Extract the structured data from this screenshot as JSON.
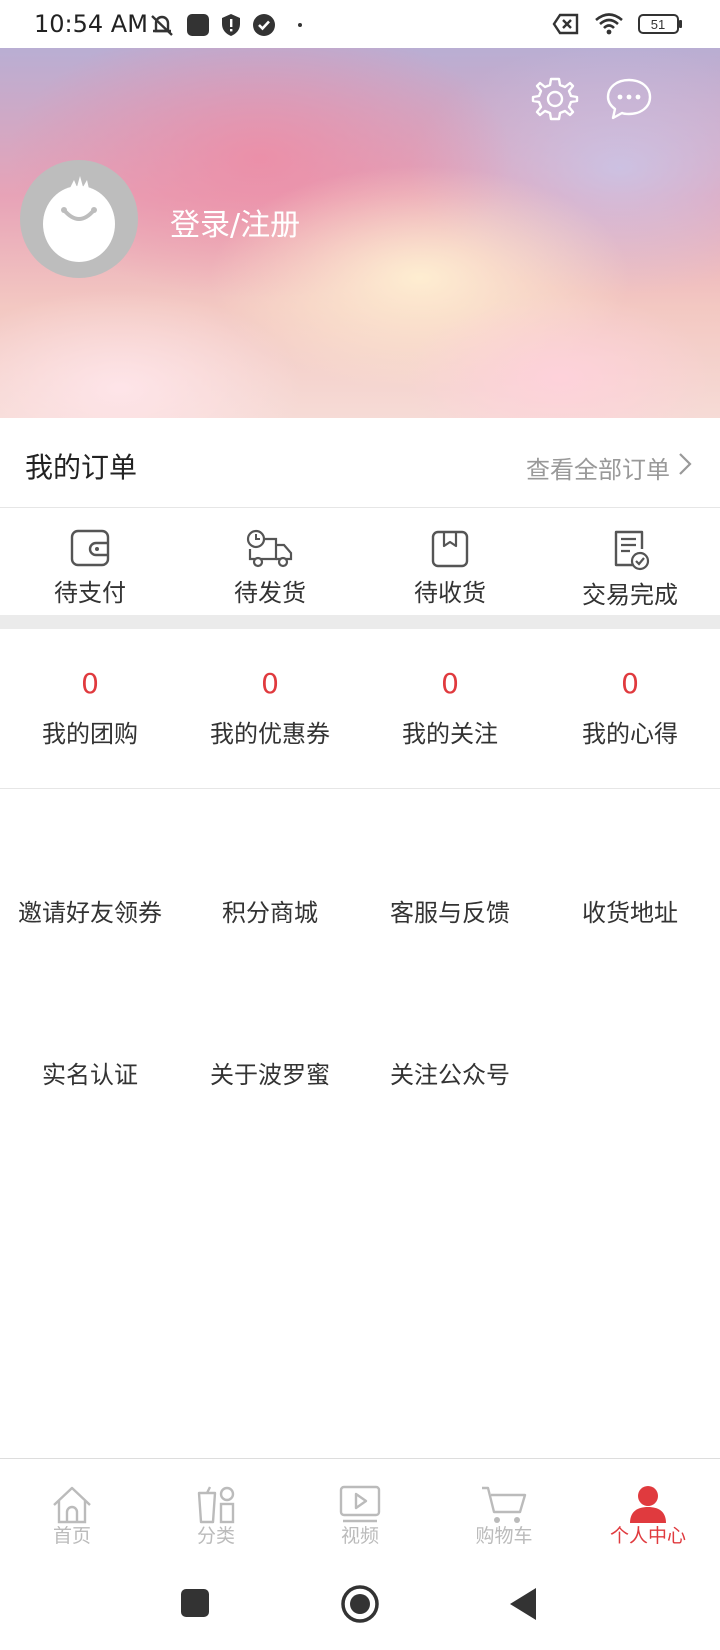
{
  "status_bar": {
    "time": "10:54 AM",
    "battery": "51"
  },
  "header": {
    "login_text": "登录/注册"
  },
  "orders": {
    "title": "我的订单",
    "view_all": "查看全部订单",
    "statuses": [
      {
        "label": "待支付",
        "icon": "wallet-icon"
      },
      {
        "label": "待发货",
        "icon": "delivery-truck-icon"
      },
      {
        "label": "待收货",
        "icon": "package-icon"
      },
      {
        "label": "交易完成",
        "icon": "receipt-check-icon"
      }
    ]
  },
  "stats": [
    {
      "count": "0",
      "label": "我的团购"
    },
    {
      "count": "0",
      "label": "我的优惠券"
    },
    {
      "count": "0",
      "label": "我的关注"
    },
    {
      "count": "0",
      "label": "我的心得"
    }
  ],
  "services": {
    "row1": [
      "邀请好友领券",
      "积分商城",
      "客服与反馈",
      "收货地址"
    ],
    "row2": [
      "实名认证",
      "关于波罗蜜",
      "关注公众号"
    ]
  },
  "tabbar": {
    "items": [
      {
        "label": "首页",
        "icon": "home-icon"
      },
      {
        "label": "分类",
        "icon": "category-icon"
      },
      {
        "label": "视频",
        "icon": "video-icon"
      },
      {
        "label": "购物车",
        "icon": "cart-icon"
      },
      {
        "label": "个人中心",
        "icon": "person-icon"
      }
    ],
    "active_index": 4
  },
  "colors": {
    "accent": "#e03a3e",
    "inactive": "#bbbbbb"
  }
}
